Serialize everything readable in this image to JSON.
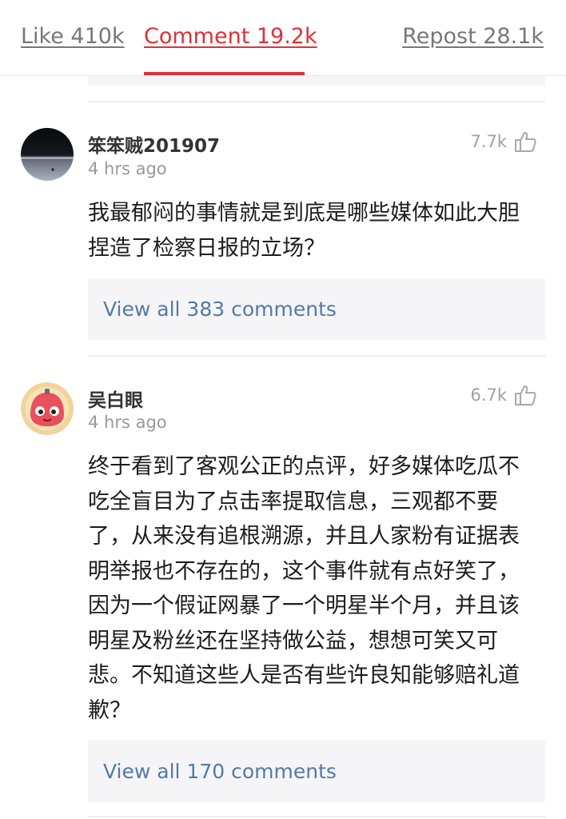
{
  "tabs": {
    "like": "Like 410k",
    "comment": "Comment 19.2k",
    "repost": "Repost 28.1k"
  },
  "colors": {
    "accent": "#e0303a",
    "link": "#5479a8",
    "muted": "#999999"
  },
  "comments": [
    {
      "user": "笨笨贼201907",
      "time": "4 hrs ago",
      "likes": "7.7k",
      "text": "我最郁闷的事情就是到底是哪些媒体如此大胆捏造了检察日报的立场？",
      "view_all": "View all 383 comments"
    },
    {
      "user": "吴白眼",
      "time": "4 hrs ago",
      "likes": "6.7k",
      "text": "终于看到了客观公正的点评，好多媒体吃瓜不吃全盲目为了点击率提取信息，三观都不要了，从来没有追根溯源，并且人家粉有证据表明举报也不存在的，这个事件就有点好笑了，因为一个假证网暴了一个明星半个月，并且该明星及粉丝还在坚持做公益，想想可笑又可悲。不知道这些人是否有些许良知能够赔礼道歉？",
      "view_all": "View all 170 comments"
    }
  ],
  "icons": {
    "like": "thumbs-up-icon"
  }
}
